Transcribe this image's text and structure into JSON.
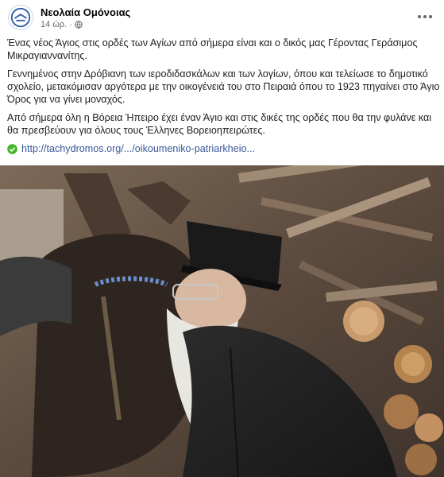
{
  "post": {
    "page_name": "Νεολαία Ομόνοιας",
    "time": "14 ώρ.",
    "separator": "·",
    "paragraphs": [
      "Ένας νέος Άγιος στις ορδές των Αγίων από σήμερα είναι και ο δικός μας Γέροντας Γεράσιμος Μικραγιαννανίτης.",
      "Γεννημένος στην Δρόβιανη των ιεροδιδασκάλων και των λογίων, όπου και τελείωσε το δημοτικό σχολείο, μετακόμισαν αργότερα με την οικογένειά του στο Πειραιά όπου το 1923 πηγαίνει στο Άγιο Όρος για να γίνει μοναχός.",
      "Από σήμερα όλη η Βόρεια Ήπειρο έχει έναν Άγιο και στις δικές της ορδές που θα την φυλάνε και θα πρεσβεύουν για όλους τους Έλληνες Βορειοηπειρώτες."
    ],
    "link_text": "http://tachydromos.org/.../oikoumeniko-patriarkheio...",
    "icons": {
      "avatar": "omonoia-logo-icon",
      "audience": "globe-icon",
      "menu": "more-options-icon",
      "link": "green-check-icon"
    },
    "photo_description_name": "post-photo"
  },
  "colors": {
    "name": "#050505",
    "meta": "#65676b",
    "link": "#385898",
    "check": "#42b72a"
  }
}
